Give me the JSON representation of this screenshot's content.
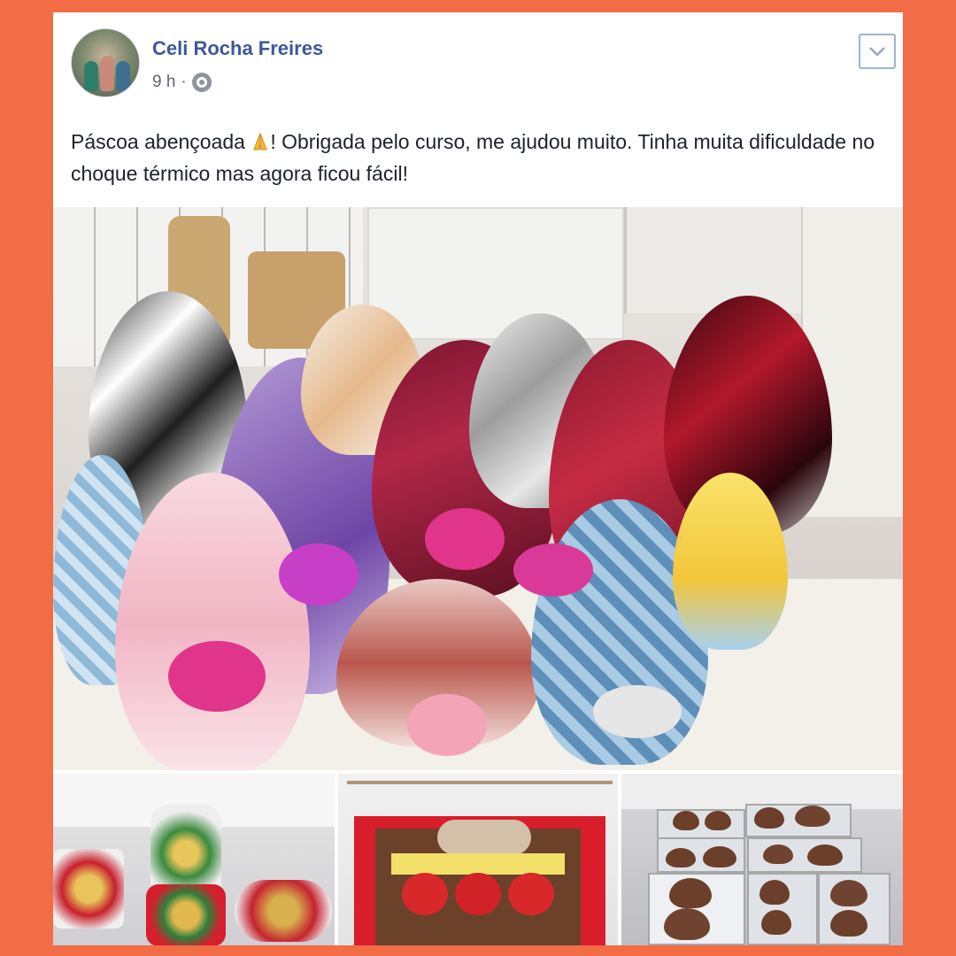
{
  "post": {
    "author": "Celi Rocha Freires",
    "time": "9 h",
    "separator": "·",
    "audience_icon": "friends-icon",
    "text_before_emoji": "Páscoa abençoada ",
    "emoji": "folded-hands",
    "text_after_emoji": "! Obrigada pelo curso, me ajudou muito. Tinha muita dificuldade no choque térmico mas agora ficou fácil!",
    "menu_icon": "chevron-down-icon"
  },
  "colors": {
    "frame": "#f26c45",
    "author": "#3b5998",
    "text": "#1d2129",
    "meta": "#616770"
  },
  "photos": [
    {
      "subject": "wrapped-easter-eggs"
    },
    {
      "subject": "small-chocolate-bags"
    },
    {
      "subject": "chocolate-strawberry-box"
    },
    {
      "subject": "chocolate-egg-molds"
    }
  ]
}
